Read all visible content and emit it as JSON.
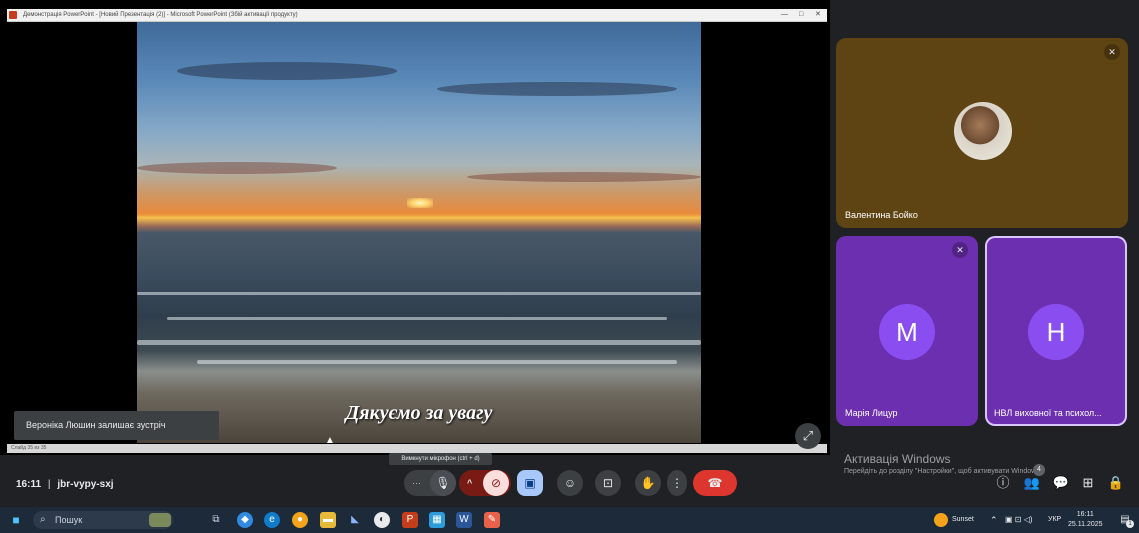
{
  "ppt": {
    "window_title": "Демонстрація PowerPoint - [Новий Презентація (2)] - Microsoft PowerPoint (Збій активації продукту)",
    "status_text": "Слайд 35 из 35",
    "window_controls": [
      "—",
      "□",
      "✕"
    ]
  },
  "slide": {
    "caption": "Дякуємо за увагу"
  },
  "toast": {
    "text": "Вероніка Люшин залишає зустріч"
  },
  "fullscreen_icon": "⤢",
  "participants": [
    {
      "name": "Валентина Бойко",
      "avatar_type": "photo"
    },
    {
      "name": "Марія Лицур",
      "initial": "M"
    },
    {
      "name": "НВЛ виховної та психол...",
      "initial": "H"
    }
  ],
  "windows_activation": {
    "title": "Активація Windows",
    "subtitle": "Перейдіть до розділу \"Настройки\", щоб активувати Windows."
  },
  "call": {
    "time": "16:11",
    "separator": "|",
    "code": "jbr-vypy-sxj",
    "tooltip": "Вимкнути мікрофон (ctrl + d)",
    "participants_badge": "4",
    "icons": {
      "more": "···",
      "mic": "🎙",
      "chevron": "^",
      "camera_off": "⊘",
      "present": "▣",
      "emoji": "☺",
      "captions": "⊡",
      "hand": "✋",
      "options": "⋮",
      "hangup": "☎",
      "info": "ⓘ",
      "people": "👥",
      "chat": "💬",
      "activities": "⊞",
      "lock": "🔒"
    }
  },
  "taskbar": {
    "search_placeholder": "Пошук",
    "weather": "Sunset",
    "language": "УКР",
    "time": "16:11",
    "date": "25.11.2025",
    "notification_count": "1"
  }
}
